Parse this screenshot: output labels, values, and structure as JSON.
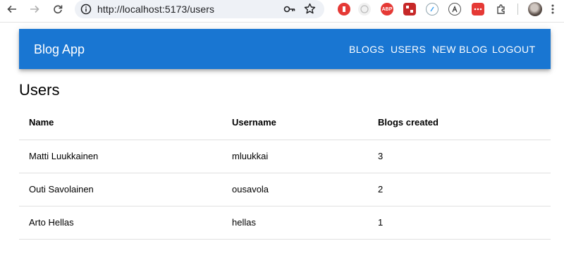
{
  "browser": {
    "url": "http://localhost:5173/users",
    "icons": {
      "back": "back-arrow-icon",
      "forward": "forward-arrow-icon",
      "reload": "reload-icon",
      "info": "site-info-icon",
      "key": "password-key-icon",
      "star": "bookmark-star-icon"
    },
    "extensions": {
      "abp_label": "ABP"
    }
  },
  "appbar": {
    "title": "Blog App",
    "nav": [
      "BLOGS",
      "USERS",
      "NEW BLOG",
      "LOGOUT"
    ],
    "color": "#1976d2"
  },
  "main": {
    "title": "Users",
    "table": {
      "headers": [
        "Name",
        "Username",
        "Blogs created"
      ],
      "rows": [
        [
          "Matti Luukkainen",
          "mluukkai",
          "3"
        ],
        [
          "Outi Savolainen",
          "ousavola",
          "2"
        ],
        [
          "Arto Hellas",
          "hellas",
          "1"
        ]
      ]
    }
  }
}
